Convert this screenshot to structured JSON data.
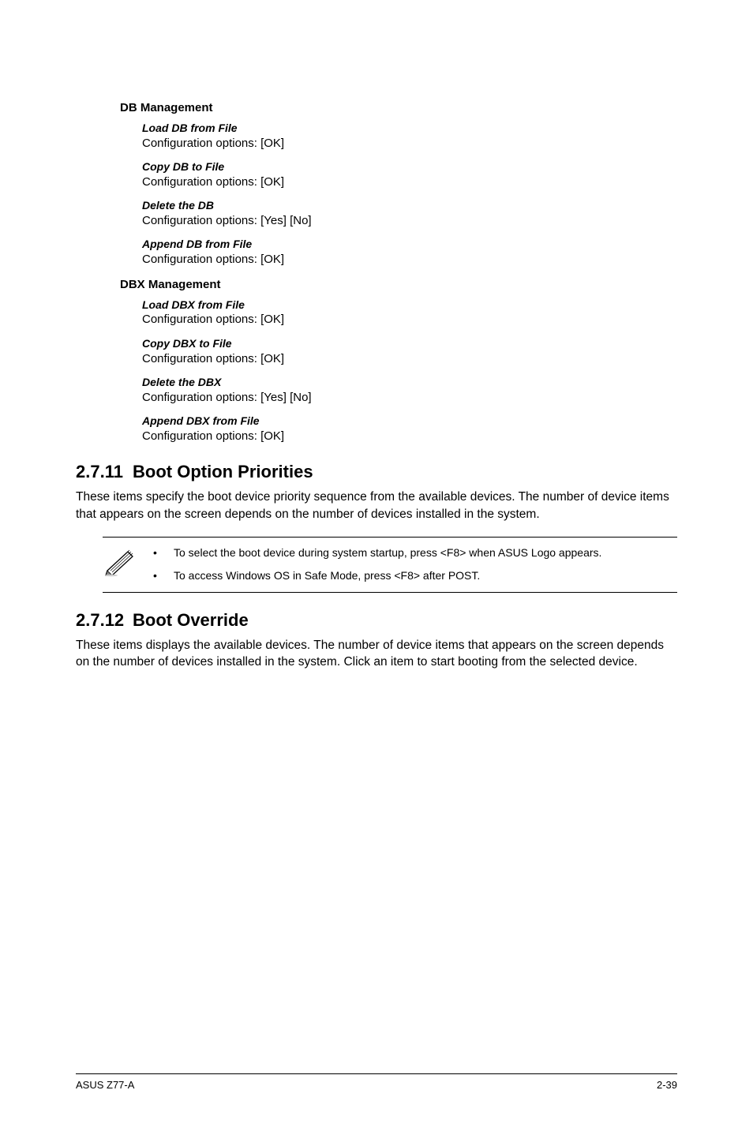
{
  "db": {
    "heading": "DB Management",
    "items": [
      {
        "title": "Load DB from File",
        "desc": "Configuration options: [OK]"
      },
      {
        "title": "Copy DB to File",
        "desc": "Configuration options: [OK]"
      },
      {
        "title": "Delete the DB",
        "desc": "Configuration options: [Yes] [No]"
      },
      {
        "title": "Append DB from File",
        "desc": "Configuration options: [OK]"
      }
    ]
  },
  "dbx": {
    "heading": "DBX Management",
    "items": [
      {
        "title": "Load DBX from File",
        "desc": "Configuration options: [OK]"
      },
      {
        "title": "Copy DBX to File",
        "desc": "Configuration options: [OK]"
      },
      {
        "title": "Delete the DBX",
        "desc": "Configuration options: [Yes] [No]"
      },
      {
        "title": "Append DBX from File",
        "desc": "Configuration options: [OK]"
      }
    ]
  },
  "s2711": {
    "num": "2.7.11",
    "title": "Boot Option Priorities",
    "body": "These items specify the boot device priority sequence from the available devices. The number of device items that appears on the screen depends on the number of devices installed in the system."
  },
  "notes": {
    "items": [
      "To select the boot device during system startup, press <F8> when ASUS Logo appears.",
      "To access Windows OS in Safe Mode, press <F8> after POST."
    ]
  },
  "s2712": {
    "num": "2.7.12",
    "title": "Boot Override",
    "body": "These items displays the available devices. The number of device items that appears on the screen depends on the number of devices installed in the system. Click an item to start booting from the selected device."
  },
  "footer": {
    "left": "ASUS Z77-A",
    "right": "2-39"
  }
}
